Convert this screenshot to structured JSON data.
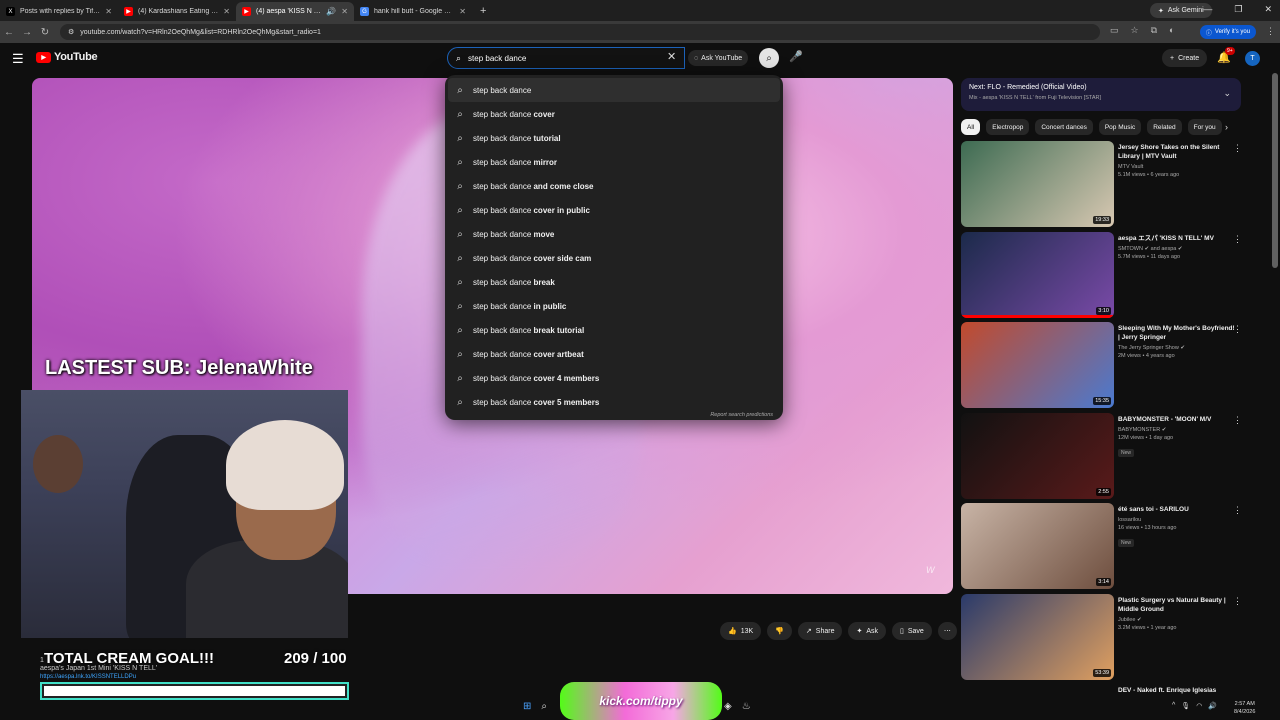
{
  "browser": {
    "tabs": [
      {
        "label": "Posts with replies by Tiffany Ja...",
        "active": false
      },
      {
        "label": "(4) Kardashians Eating Salads",
        "active": false
      },
      {
        "label": "(4) aespa 'KISS N TELL' from...",
        "active": true
      },
      {
        "label": "hank hill butt - Google Search",
        "active": false
      }
    ],
    "gemini_label": "Ask Gemini",
    "url": "youtube.com/watch?v=HRln2OeQhMg&list=RDHRln2OeQhMg&start_radio=1",
    "verify_label": "Verify it's you"
  },
  "youtube": {
    "logo_text": "YouTube",
    "search": {
      "value": "step back dance",
      "ask_label": "Ask YouTube"
    },
    "create_label": "Create",
    "notif_count": "9+",
    "avatar_letter": "T"
  },
  "suggestions": [
    {
      "base": "step back dance",
      "rest": ""
    },
    {
      "base": "step back dance ",
      "rest": "cover"
    },
    {
      "base": "step back dance ",
      "rest": "tutorial"
    },
    {
      "base": "step back dance ",
      "rest": "mirror"
    },
    {
      "base": "step back dance ",
      "rest": "and come close"
    },
    {
      "base": "step back dance ",
      "rest": "cover in public"
    },
    {
      "base": "step back dance ",
      "rest": "move"
    },
    {
      "base": "step back dance ",
      "rest": "cover side cam"
    },
    {
      "base": "step back dance ",
      "rest": "break"
    },
    {
      "base": "step back dance ",
      "rest": "in public"
    },
    {
      "base": "step back dance ",
      "rest": "break tutorial"
    },
    {
      "base": "step back dance ",
      "rest": "cover artbeat"
    },
    {
      "base": "step back dance ",
      "rest": "cover 4 members"
    },
    {
      "base": "step back dance ",
      "rest": "cover 5 members"
    }
  ],
  "report_label": "Report search predictions",
  "overlay": {
    "lastsub": "LASTEST SUB: JelenaWhite",
    "goal_label": "TOTAL CREAM GOAL!!!",
    "goal_count": "209 / 100",
    "goal_progress": 1.0,
    "kick_text": "kick.com/tippy"
  },
  "description": {
    "line1": "1",
    "line2": "aespa's Japan 1st Mini 'KISS N TELL'",
    "link": "https://aespa.lnk.to/KISSNTELLDPu"
  },
  "actions": {
    "likes": "13K",
    "share": "Share",
    "ask": "Ask",
    "save": "Save"
  },
  "next": {
    "title": "Next: FLO - Remedied (Official Video)",
    "sub": "Mix - aespa 'KISS N TELL' from Fuji Television [STAR]"
  },
  "chips": [
    "All",
    "Electropop",
    "Concert dances",
    "Pop Music",
    "Related",
    "For you"
  ],
  "related": [
    {
      "title": "Jersey Shore Takes on the Silent Library | MTV Vault",
      "channel": "MTV Vault",
      "meta": "5.1M views • 6 years ago",
      "duration": "19:33",
      "new": "",
      "colors": [
        "#3d6b52",
        "#d8c8b2"
      ]
    },
    {
      "title": "aespa エスパ 'KISS N TELL' MV",
      "channel": "SMTOWN ✔ and aespa ✔",
      "meta": "5.7M views • 11 days ago",
      "duration": "3:10",
      "new": "",
      "colors": [
        "#1b2a4a",
        "#7a4aa8"
      ]
    },
    {
      "title": "Sleeping With My Mother's Boyfriend! | Jerry Springer",
      "channel": "The Jerry Springer Show ✔",
      "meta": "2M views • 4 years ago",
      "duration": "15:35",
      "new": "",
      "colors": [
        "#c24a2c",
        "#4a7ad0"
      ]
    },
    {
      "title": "BABYMONSTER - 'MOON' M/V",
      "channel": "BABYMONSTER ✔",
      "meta": "12M views • 1 day ago",
      "duration": "2:55",
      "new": "New",
      "colors": [
        "#111111",
        "#5a1a1a"
      ]
    },
    {
      "title": "été sans toi - SARILOU",
      "channel": "lossarilou",
      "meta": "16 views • 13 hours ago",
      "duration": "3:14",
      "new": "New",
      "colors": [
        "#c8b4a6",
        "#6e4e3e"
      ]
    },
    {
      "title": "Plastic Surgery vs Natural Beauty | Middle Ground",
      "channel": "Jubilee ✔",
      "meta": "3.2M views • 1 year ago",
      "duration": "53:39",
      "new": "",
      "colors": [
        "#2a3a6a",
        "#e0a060"
      ]
    }
  ],
  "related_partial": "DEV - Naked ft. Enrique Iglesias",
  "taskbar": {
    "time": "2:57 AM",
    "date": "8/4/2026"
  }
}
